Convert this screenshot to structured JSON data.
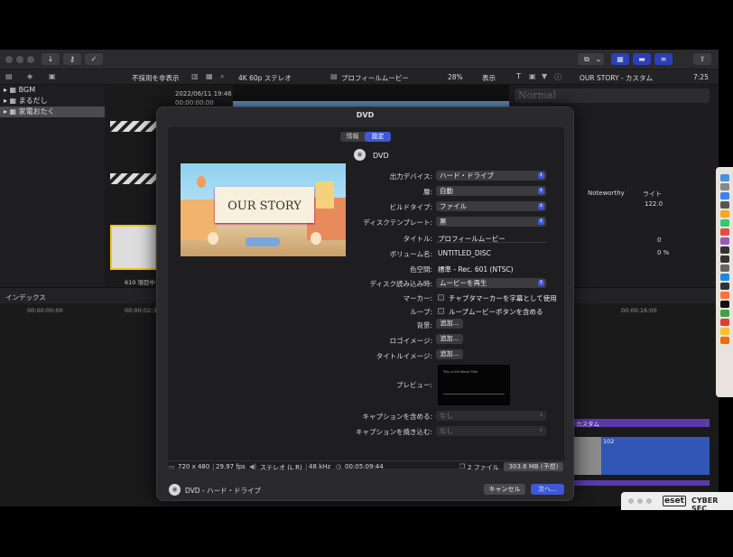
{
  "toolbar": {
    "time": "7:25"
  },
  "browser": {
    "filter_label": "不採用を非表示",
    "libraries": [
      "BGM",
      "まるだし",
      "家電おたく"
    ],
    "clip_date": "2022/06/11 19:46",
    "clip_time": "00:00:00:00",
    "clip_count": "610 項目中 1"
  },
  "viewer": {
    "format": "4K 60p ステレオ",
    "project": "プロフィールムービー",
    "zoom": "28%",
    "view_menu": "表示"
  },
  "inspector": {
    "title": "OUR  STORY - カスタム",
    "preset": "Normal",
    "font": "Noteworthy",
    "weight": "ライト",
    "size": "122.0",
    "v1": "0",
    "v2": "0 %"
  },
  "timeline": {
    "index_label": "インデックス",
    "t0": "00:00:00:00",
    "t1": "00:00:02:30",
    "t2": "00:00:16:00",
    "clip_label": "カスタム",
    "clip_num": "102"
  },
  "dialog": {
    "title": "DVD",
    "tabs": [
      "情報",
      "設定"
    ],
    "active_tab": "設定",
    "dest_name": "DVD",
    "thumb_text": "OUR  STORY",
    "fields": {
      "output_device_label": "出力デバイス:",
      "output_device": "ハード・ドライブ",
      "layers_label": "層:",
      "layers": "自動",
      "build_type_label": "ビルドタイプ:",
      "build_type": "ファイル",
      "template_label": "ディスクテンプレート:",
      "template": "黒",
      "title_label": "タイトル:",
      "title_value": "プロフィールムービー",
      "volume_label": "ボリューム名:",
      "volume_value": "UNTITLED_DISC",
      "colorspace_label": "色空間:",
      "colorspace_value": "標準 - Rec. 601 (NTSC)",
      "onload_label": "ディスク読み込み時:",
      "onload": "ムービーを再生",
      "markers_label": "マーカー:",
      "markers_check": "チャプタマーカーを字幕として使用",
      "loop_label": "ループ:",
      "loop_check": "ループムービーボタンを含める",
      "background_label": "背景:",
      "logo_label": "ロゴイメージ:",
      "title_image_label": "タイトルイメージ:",
      "add_button": "追加...",
      "preview_label": "プレビュー:",
      "preview_text": "This is the Movie Title",
      "captions_include_label": "キャプションを含める:",
      "captions_include": "なし",
      "captions_burn_label": "キャプションを焼き込む:",
      "captions_burn": "なし"
    },
    "footer": {
      "resolution": "720 x 480",
      "fps": "29.97 fps",
      "audio": "ステレオ (L R)",
      "rate": "48 kHz",
      "duration": "00:05:09:44",
      "files": "2 ファイル",
      "size": "303.6 MB (予想)"
    },
    "bottom": {
      "dest": "DVD - ハード・ドライブ",
      "cancel": "キャンセル",
      "next": "次へ..."
    }
  },
  "eset": {
    "label": "CYBER SEC"
  }
}
